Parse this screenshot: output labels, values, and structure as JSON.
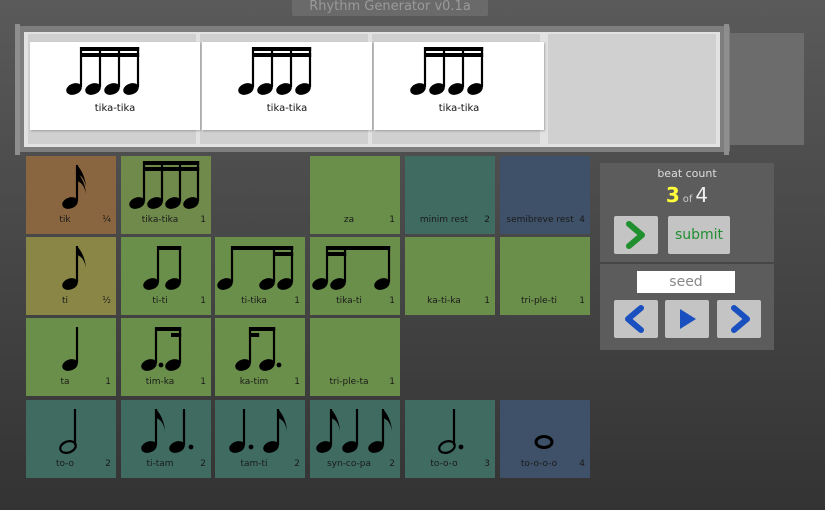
{
  "app": {
    "title": "Rhythm Generator v0.1a"
  },
  "staff": {
    "measures": [
      {
        "label": "tika-tika"
      },
      {
        "label": "tika-tika"
      },
      {
        "label": "tika-tika"
      }
    ]
  },
  "palette": [
    {
      "name": "tik",
      "beats": "1/4",
      "color": "#8a6640",
      "icon": "sixteenth-note-icon"
    },
    {
      "name": "tika-tika",
      "beats": "1",
      "color": "#6f8a4b",
      "icon": "four-sixteenths-icon"
    },
    {
      "name": "za",
      "beats": "1",
      "color": "#6a8f4a",
      "icon": "blank"
    },
    {
      "name": "minim rest",
      "beats": "2",
      "color": "#3f6b60",
      "icon": "blank"
    },
    {
      "name": "semibreve rest",
      "beats": "4",
      "color": "#3e5168",
      "icon": "blank"
    },
    {
      "name": "ti",
      "beats": "1/2",
      "color": "#8a8646",
      "icon": "eighth-note-icon"
    },
    {
      "name": "ti-ti",
      "beats": "1",
      "color": "#6a8f4a",
      "icon": "two-eighths-icon"
    },
    {
      "name": "ti-tika",
      "beats": "1",
      "color": "#6a8f4a",
      "icon": "eighth-two-sixteenths-icon"
    },
    {
      "name": "tika-ti",
      "beats": "1",
      "color": "#6a8f4a",
      "icon": "two-sixteenths-eighth-icon"
    },
    {
      "name": "ka-ti-ka",
      "beats": "1",
      "color": "#6a8f4a",
      "icon": "blank"
    },
    {
      "name": "tri-ple-ti",
      "beats": "1",
      "color": "#6a8f4a",
      "icon": "blank"
    },
    {
      "name": "ta",
      "beats": "1",
      "color": "#6a8f4a",
      "icon": "quarter-note-icon"
    },
    {
      "name": "tim-ka",
      "beats": "1",
      "color": "#6a8f4a",
      "icon": "dotted-eighth-sixteenth-icon"
    },
    {
      "name": "ka-tim",
      "beats": "1",
      "color": "#6a8f4a",
      "icon": "sixteenth-dotted-eighth-icon"
    },
    {
      "name": "tri-ple-ta",
      "beats": "1",
      "color": "#6a8f4a",
      "icon": "blank"
    },
    {
      "name": "to-o",
      "beats": "2",
      "color": "#3f6b60",
      "icon": "half-note-icon"
    },
    {
      "name": "ti-tam",
      "beats": "2",
      "color": "#3f6b60",
      "icon": "eighth-dotted-quarter-icon"
    },
    {
      "name": "tam-ti",
      "beats": "2",
      "color": "#3f6b60",
      "icon": "dotted-quarter-eighth-icon"
    },
    {
      "name": "syn-co-pa",
      "beats": "2",
      "color": "#3f6b60",
      "icon": "syncopation-icon"
    },
    {
      "name": "to-o-o",
      "beats": "3",
      "color": "#3f6b60",
      "icon": "dotted-half-note-icon"
    },
    {
      "name": "to-o-o-o",
      "beats": "4",
      "color": "#3e5168",
      "icon": "whole-note-icon"
    }
  ],
  "beat_count": {
    "label": "beat count",
    "current": "3",
    "of": "of",
    "total": "4"
  },
  "controls": {
    "submit_label": "submit",
    "seed_placeholder": "seed"
  },
  "colors": {
    "accent_green": "#1f8f2f",
    "accent_blue": "#1a4fc0",
    "current_beat": "#ffff3a"
  }
}
